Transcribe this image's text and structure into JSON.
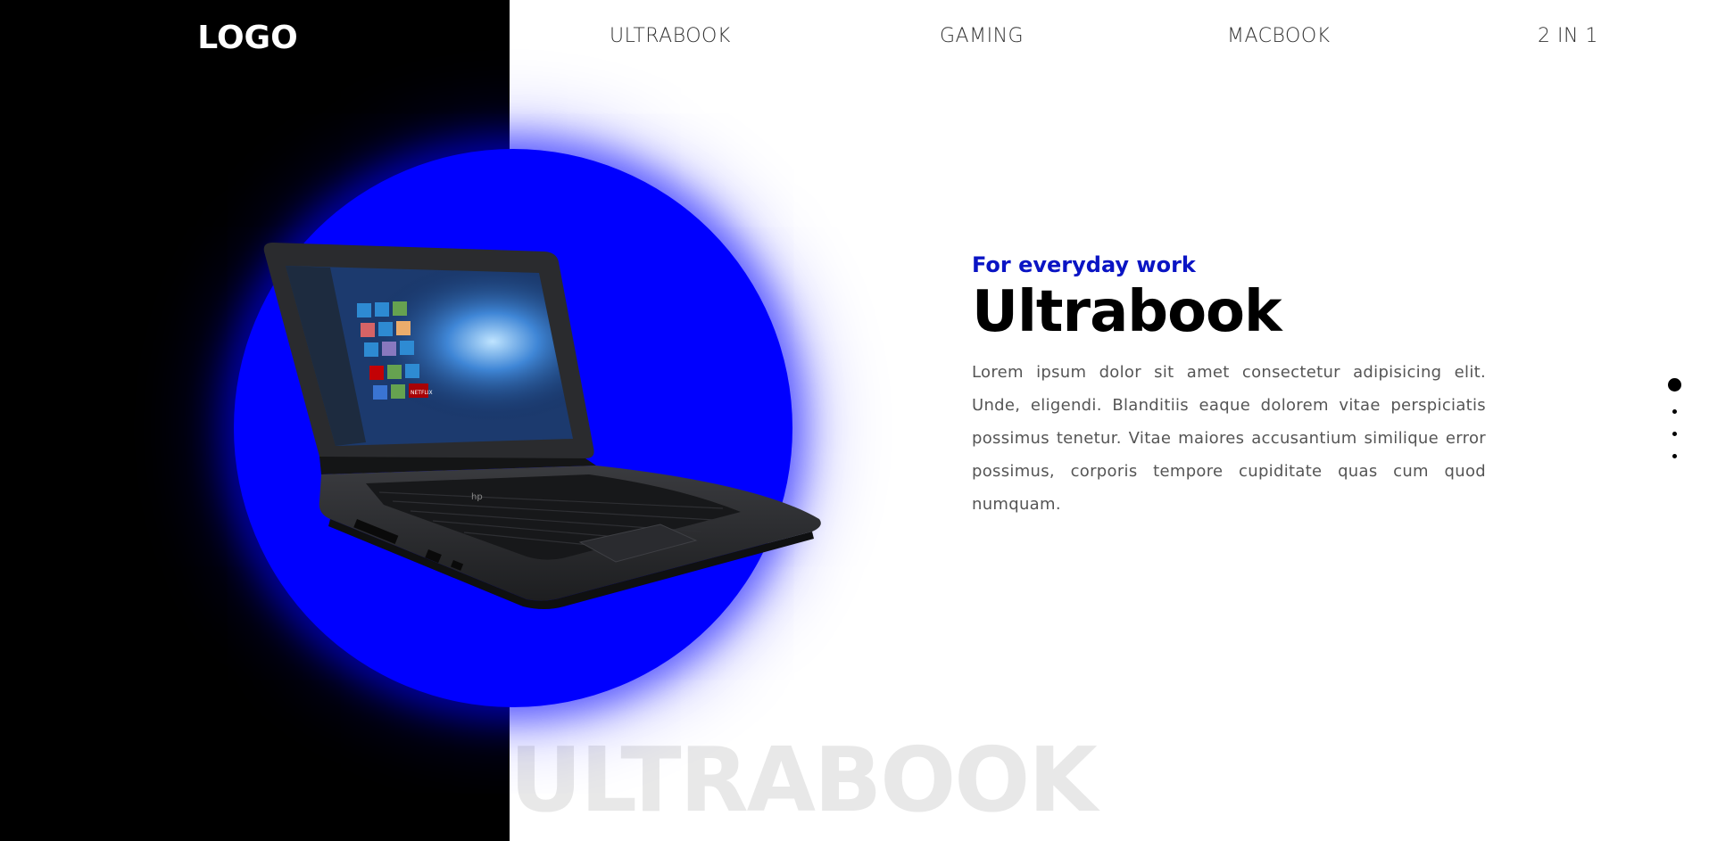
{
  "header": {
    "logo": "LOGO",
    "nav": [
      "ULTRABOOK",
      "GAMING",
      "MACBOOK",
      "2 IN 1"
    ]
  },
  "hero": {
    "subtitle": "For everyday work",
    "title": "Ultrabook",
    "description": "Lorem ipsum dolor sit amet consectetur adipisicing elit. Unde, eligendi. Blanditiis eaque dolorem vitae perspiciatis possimus tenetur. Vitae maiores accusantium similique error possimus, corporis tempore cupiditate quas cum quod numquam.",
    "watermark": "ULTRABOOK",
    "image_label": "Laptop product image",
    "laptop_brand": "hp",
    "laptop_badge": "NETFLIX"
  },
  "slider": {
    "count": 4,
    "active": 1
  },
  "colors": {
    "accent_blue": "#0000ff",
    "subtitle_blue": "#0a14c4",
    "left_panel": "#000000",
    "watermark": "#e8e8e8"
  }
}
